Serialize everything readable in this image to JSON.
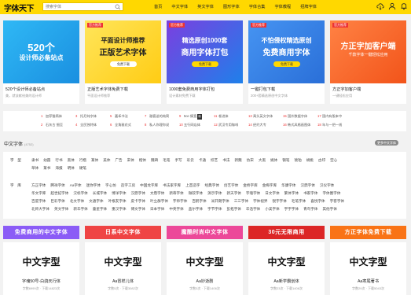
{
  "header": {
    "logo": "字体天下",
    "search_placeholder": "搜索字体",
    "nav": [
      "首页",
      "中文字体",
      "英文字体",
      "图形字体",
      "字体合集",
      "字体教程",
      "招牌字体"
    ]
  },
  "banners": [
    {
      "big1": "520个",
      "big2": "设计师必备站点",
      "title": "520个设计师必备站点",
      "sub": "美，就该献给美的设计师",
      "colors": [
        "#2ab0f0",
        "#1a8fe0"
      ]
    },
    {
      "tag": "官方推荐",
      "big1": "平面设计师推荐",
      "big2": "正版艺术字体",
      "btn": "免费下载",
      "title": "正版艺术字体免费下载",
      "sub": "平面设计师推荐",
      "colors": [
        "#ffe14d",
        "#ffcf1a"
      ]
    },
    {
      "tag": "官方推荐",
      "big1": "精选原创1000套",
      "big2": "商用字体打包",
      "btn": "免费下载",
      "title": "1000套免费商用字体打包",
      "sub": "设计素材免费下载",
      "colors": [
        "#6a3cd6",
        "#1e7be8"
      ]
    },
    {
      "tag": "官方推荐",
      "big1": "不怕侵权精选原创",
      "big2": "免费商用字体",
      "btn": "免费下载",
      "title": "一键打包下载",
      "sub": "200+套精选原创中文字体",
      "colors": [
        "#3d8bf0",
        "#2a6fd8"
      ]
    },
    {
      "tag": "官方推荐",
      "big1": "方正字加客户端",
      "big2": "千款字体一键轻松应用",
      "title": "方正字加客户端",
      "sub": "一键轻松应用",
      "colors": [
        "#ff7a3d",
        "#f55a1e"
      ]
    }
  ],
  "ranking": [
    {
      "n": "1",
      "t": "加菲猫简体"
    },
    {
      "n": "3",
      "t": "托尼纯字体"
    },
    {
      "n": "5",
      "t": "嘉禾书法"
    },
    {
      "n": "7",
      "t": "雅客送的纯简"
    },
    {
      "n": "9",
      "t": "5ce 情宽",
      "new": "新"
    },
    {
      "n": "11",
      "t": "卷进体"
    },
    {
      "n": "13",
      "t": "禹头英文字体"
    },
    {
      "n": "15",
      "t": "国外数据字体"
    },
    {
      "n": "17",
      "t": "国内有股本中"
    },
    {
      "n": "2",
      "t": "石灰古 细至"
    },
    {
      "n": "4",
      "t": "全民独特体"
    },
    {
      "n": "6",
      "t": "全角雅花式"
    },
    {
      "n": "8",
      "t": "私人你理你说"
    },
    {
      "n": "10",
      "t": "五行网店体"
    },
    {
      "n": "12",
      "t": "武汉专用咖啡"
    },
    {
      "n": "14",
      "t": "经约大专"
    },
    {
      "n": "16",
      "t": "韩式风格画图体"
    },
    {
      "n": "18",
      "t": "年与一把一线"
    }
  ],
  "section": {
    "title": "中文字体",
    "count": "(4752)",
    "more": "更多中文字体"
  },
  "categories": [
    {
      "key": "字　型",
      "vals": [
        "隶书",
        "幼圆",
        "行书",
        "黑体",
        "行楷",
        "篆体",
        "美体",
        "广告",
        "宋体",
        "楷体",
        "魏碑",
        "毛笔",
        "手写",
        "彩云",
        "卡通",
        "综艺",
        "书法",
        "新魏",
        "仿宋",
        "大黑",
        "姚体",
        "钢笔",
        "琥珀",
        "胡桃",
        "古印",
        "空心"
      ]
    },
    {
      "key": "",
      "vals": [
        "草体",
        "篆书",
        "海报",
        "明体",
        "硬笔"
      ]
    },
    {
      "key": "字　库",
      "vals": [
        "方正字体",
        "腾祥字体",
        "Aa字体",
        "迷你字体",
        "字心坊",
        "造字工房",
        "中国龙字库",
        "书法家字库",
        "上首造字",
        "经典字体",
        "创艺字体",
        "金桥字库",
        "金梅字库",
        "华康字体",
        "汉鼎字体",
        "汉仪字体"
      ]
    },
    {
      "key": "",
      "vals": [
        "华文字库",
        "超世纪字体",
        "汉标字体",
        "长城字体",
        "博洋字体",
        "汉鼎字体",
        "文鼎字体",
        "新蒂字体",
        "微软字体",
        "演示字体",
        "新天字体",
        "字魂字体",
        "日文字体",
        "繁体字体",
        "书家字体",
        "字体圈字体"
      ]
    },
    {
      "key": "",
      "vals": [
        "百度字体",
        "巨彩字体",
        "北文字体",
        "文通字体",
        "叶根友字体",
        "皮卡字体",
        "叶立群字体",
        "字师字体",
        "百鹤字体",
        "米开朗字体",
        "三三字体",
        "字体视界",
        "锐字字体",
        "毛笔字体",
        "喜悦字体",
        "字客字体"
      ]
    },
    {
      "key": "",
      "vals": [
        "北师大字体",
        "英文字体",
        "新华字体",
        "童星字体",
        "重汉字体",
        "博文字体",
        "日本字体",
        "中英字体",
        "盖尔字体",
        "字节字体",
        "彭拓字体",
        "华浩字体",
        "小美字体",
        "宇宇字体",
        "青鸟字体",
        "其他字体"
      ]
    }
  ],
  "promos": [
    {
      "label": "免费商用的中文字体",
      "color": "#8b5cf6"
    },
    {
      "label": "日系中文字体",
      "color": "#ef4444"
    },
    {
      "label": "魔酷时尚中文字体",
      "color": "#ec4899"
    },
    {
      "label": "30元无限商用",
      "color": "#dc2626"
    },
    {
      "label": "方正字体免费下载",
      "color": "#f97316"
    }
  ],
  "fonts": [
    {
      "preview": "中文字型",
      "name": "字魂50号-白鸽天行体",
      "meta": "字数6999次 · 下载14823次"
    },
    {
      "preview": "中文字型",
      "name": "Aa冒样儿体",
      "meta": "字数5次 · 下载3082次"
    },
    {
      "preview": "中文字型",
      "name": "Aa妙逝剧",
      "meta": "字数3次 · 下载1406次"
    },
    {
      "preview": "中文字型",
      "name": "Aa新学霸创体",
      "meta": "字数23次 · 下载1406次"
    },
    {
      "preview": "中文字型",
      "name": "Aa寒尾著书",
      "meta": "字数29次 · 下载5043次"
    }
  ]
}
